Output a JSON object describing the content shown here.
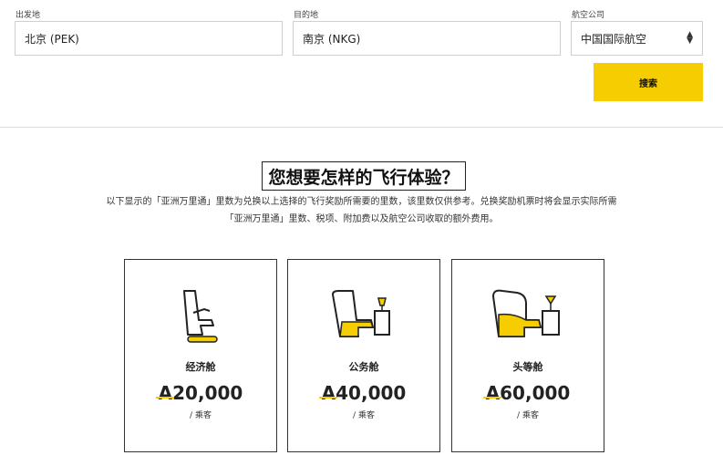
{
  "search": {
    "origin_label": "出发地",
    "origin_value": "北京 (PEK)",
    "destination_label": "目的地",
    "destination_value": "南京 (NKG)",
    "airline_label": "航空公司",
    "airline_value": "中国国际航空",
    "submit_label": "搜索"
  },
  "experience": {
    "heading": "您想要怎样的飞行体验？",
    "intro_line1": "以下显示的「亚洲万里通」里数为兑换以上选择的飞行奖励所需要的里数，该里数仅供参考。兑换奖励机票时将会显示实际所需",
    "intro_line2": "「亚洲万里通」里数、税项、附加费以及航空公司收取的额外费用。"
  },
  "cabins": [
    {
      "name": "经济舱",
      "currency": "A",
      "miles": "20,000",
      "per": "/ 乘客",
      "icon": "economy-seat-icon"
    },
    {
      "name": "公务舱",
      "currency": "A",
      "miles": "40,000",
      "per": "/ 乘客",
      "icon": "business-seat-icon"
    },
    {
      "name": "头等舱",
      "currency": "A",
      "miles": "60,000",
      "per": "/ 乘客",
      "icon": "first-seat-icon"
    }
  ],
  "colors": {
    "accent": "#f5cd00",
    "text": "#222222",
    "border": "#cfcfcf"
  }
}
